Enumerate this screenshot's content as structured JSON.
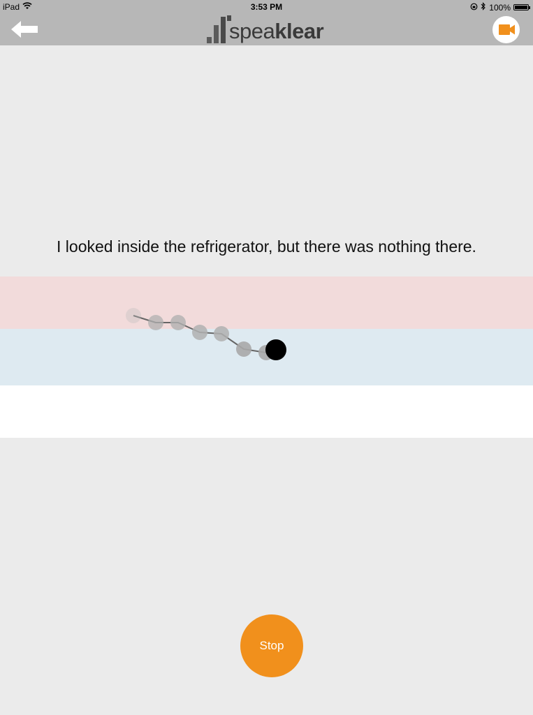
{
  "status_bar": {
    "device": "iPad",
    "time": "3:53 PM",
    "battery_percent": "100%",
    "battery_level": 1.0
  },
  "nav": {
    "logo_prefix": "spea",
    "logo_suffix": "klear",
    "back_icon": "arrow-left-icon",
    "video_icon": "video-camera-icon",
    "accent_color": "#f1901c"
  },
  "sentence": "I looked inside the refrigerator, but there was nothing there.",
  "pitch_trace": {
    "point_color": "#9a9a9a",
    "current_point_color": "#000000"
  },
  "stop_button": {
    "label": "Stop",
    "color": "#f1901c"
  },
  "bands": {
    "upper_color": "#f2dbdb",
    "target_color": "#deeaf1",
    "lower_color": "#ffffff"
  }
}
